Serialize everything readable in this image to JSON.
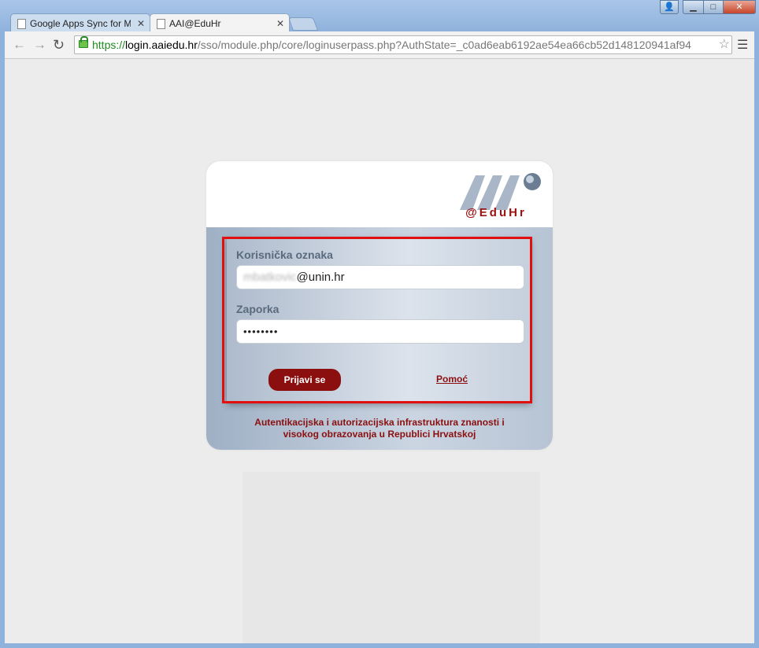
{
  "tabs": [
    {
      "label": "Google Apps Sync for Mic"
    },
    {
      "label": "AAI@EduHr"
    }
  ],
  "address": {
    "scheme": "https://",
    "host": "login.aaiedu.hr",
    "path": "/sso/module.php/core/loginuserpass.php?AuthState=_c0ad6eab6192ae54ea66cb52d148120941af94"
  },
  "logo": {
    "text": "@EduHr"
  },
  "form": {
    "username_label": "Korisnička oznaka",
    "username_prefix": "mbatkovic",
    "username_suffix": "@unin.hr",
    "password_label": "Zaporka",
    "password_value": "••••••••",
    "login_button": "Prijavi se",
    "help_link": "Pomoć"
  },
  "footer": {
    "line1": "Autentikacijska i autorizacijska infrastruktura znanosti i",
    "line2": "visokog obrazovanja u Republici Hrvatskoj"
  },
  "colors": {
    "brand": "#8b0f0f",
    "highlight": "#e01010"
  }
}
